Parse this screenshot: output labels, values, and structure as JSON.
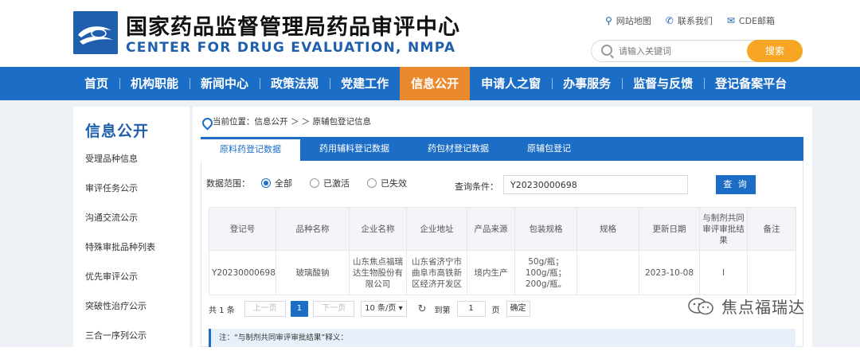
{
  "header": {
    "title_cn": "国家药品监督管理局药品审评中心",
    "title_en": "CENTER FOR DRUG EVALUATION, NMPA",
    "top_links": [
      {
        "label": "网站地图",
        "icon": "location-pin-icon"
      },
      {
        "label": "联系我们",
        "icon": "phone-icon"
      },
      {
        "label": "CDE邮箱",
        "icon": "mail-icon"
      }
    ],
    "search": {
      "placeholder": "请输入关键词",
      "button": "搜索"
    }
  },
  "nav": {
    "items": [
      "首页",
      "机构职能",
      "新闻中心",
      "政策法规",
      "党建工作",
      "信息公开",
      "申请人之窗",
      "办事服务",
      "监督与反馈",
      "登记备案平台"
    ],
    "active": "信息公开"
  },
  "sidebar": {
    "title": "信息公开",
    "items": [
      "受理品种信息",
      "审评任务公示",
      "沟通交流公示",
      "特殊审批品种列表",
      "优先审评公示",
      "突破性治疗公示",
      "三合一序列公示"
    ]
  },
  "breadcrumb": {
    "text": "当前位置：信息公开 ＞ ＞ 原辅包登记信息"
  },
  "tabs": [
    "原料药登记数据",
    "药用辅料登记数据",
    "药包材登记数据",
    "原辅包登记"
  ],
  "filters": {
    "scope_label": "数据范围：",
    "options": [
      "全部",
      "已激活",
      "已失效"
    ],
    "selected": "全部",
    "condition_label": "查询条件：",
    "condition_value": "Y20230000698",
    "query_button": "查 询"
  },
  "table": {
    "headers": [
      "登记号",
      "品种名称",
      "企业名称",
      "企业地址",
      "产品来源",
      "包装规格",
      "规格",
      "更新日期",
      "与制剂共同审评审批结果",
      "备注"
    ],
    "rows": [
      [
        "Y20230000698",
        "玻璃酸钠",
        "山东焦点福瑞达生物股份有限公司",
        "山东省济宁市曲阜市高铁新区经济开发区",
        "境内生产",
        "50g/瓶；100g/瓶；200g/瓶。",
        "",
        "2023-10-08",
        "I",
        ""
      ]
    ]
  },
  "pager": {
    "total": "共 1 条",
    "prev": "上一页",
    "current": "1",
    "next": "下一页",
    "page_size": "10 条/页",
    "goto_label": "到第",
    "goto_value": "1",
    "page_unit": "页",
    "confirm": "确定"
  },
  "note": {
    "text": "注：“与制剂共同审评审批结果”释义："
  },
  "watermark": {
    "text": "焦点福瑞达"
  },
  "colors": {
    "primary": "#1c6dc6",
    "accent": "#ea8a2c",
    "search_button": "#f6a623"
  }
}
